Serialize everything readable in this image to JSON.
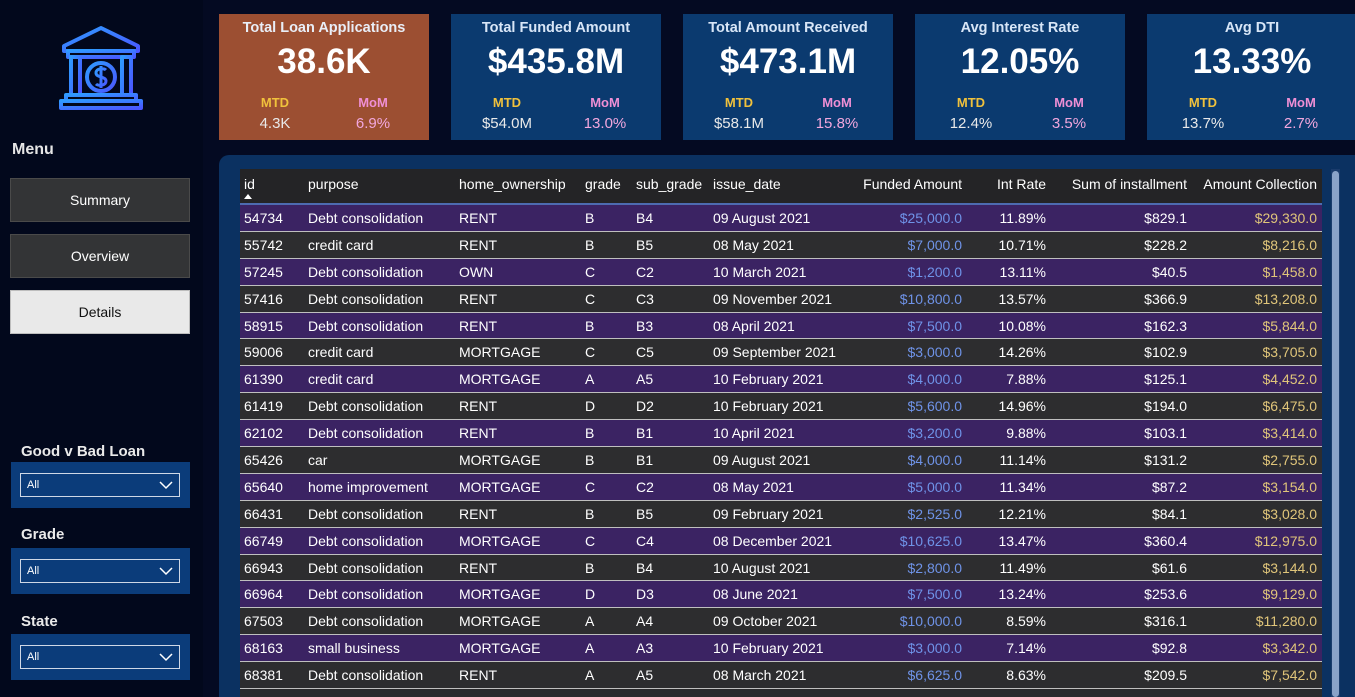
{
  "sidebar": {
    "menu_title": "Menu",
    "nav": [
      {
        "label": "Summary",
        "active": false
      },
      {
        "label": "Overview",
        "active": false
      },
      {
        "label": "Details",
        "active": true
      }
    ],
    "filters": [
      {
        "label": "Good v Bad Loan",
        "value": "All"
      },
      {
        "label": "Grade",
        "value": "All"
      },
      {
        "label": "State",
        "value": "All"
      }
    ],
    "logo_icon": "bank-dollar-icon"
  },
  "kpis": [
    {
      "title": "Total Loan Applications",
      "value": "38.6K",
      "mtd_label": "MTD",
      "mtd": "4.3K",
      "mom_label": "MoM",
      "mom": "6.9%",
      "color": "#9c4f32"
    },
    {
      "title": "Total Funded Amount",
      "value": "$435.8M",
      "mtd_label": "MTD",
      "mtd": "$54.0M",
      "mom_label": "MoM",
      "mom": "13.0%",
      "color": "#0b3a6f"
    },
    {
      "title": "Total Amount Received",
      "value": "$473.1M",
      "mtd_label": "MTD",
      "mtd": "$58.1M",
      "mom_label": "MoM",
      "mom": "15.8%",
      "color": "#0b3a6f"
    },
    {
      "title": "Avg Interest Rate",
      "value": "12.05%",
      "mtd_label": "MTD",
      "mtd": "12.4%",
      "mom_label": "MoM",
      "mom": "3.5%",
      "color": "#0b3a6f"
    },
    {
      "title": "Avg DTI",
      "value": "13.33%",
      "mtd_label": "MTD",
      "mtd": "13.7%",
      "mom_label": "MoM",
      "mom": "2.7%",
      "color": "#0b3a6f"
    }
  ],
  "table": {
    "columns": [
      "id",
      "purpose",
      "home_ownership",
      "grade",
      "sub_grade",
      "issue_date",
      "Funded Amount",
      "Int Rate",
      "Sum of installment",
      "Amount Collection"
    ],
    "rows": [
      [
        "54734",
        "Debt consolidation",
        "RENT",
        "B",
        "B4",
        "09 August 2021",
        "$25,000.0",
        "11.89%",
        "$829.1",
        "$29,330.0"
      ],
      [
        "55742",
        "credit card",
        "RENT",
        "B",
        "B5",
        "08 May 2021",
        "$7,000.0",
        "10.71%",
        "$228.2",
        "$8,216.0"
      ],
      [
        "57245",
        "Debt consolidation",
        "OWN",
        "C",
        "C2",
        "10 March 2021",
        "$1,200.0",
        "13.11%",
        "$40.5",
        "$1,458.0"
      ],
      [
        "57416",
        "Debt consolidation",
        "RENT",
        "C",
        "C3",
        "09 November 2021",
        "$10,800.0",
        "13.57%",
        "$366.9",
        "$13,208.0"
      ],
      [
        "58915",
        "Debt consolidation",
        "RENT",
        "B",
        "B3",
        "08 April 2021",
        "$7,500.0",
        "10.08%",
        "$162.3",
        "$5,844.0"
      ],
      [
        "59006",
        "credit card",
        "MORTGAGE",
        "C",
        "C5",
        "09 September 2021",
        "$3,000.0",
        "14.26%",
        "$102.9",
        "$3,705.0"
      ],
      [
        "61390",
        "credit card",
        "MORTGAGE",
        "A",
        "A5",
        "10 February 2021",
        "$4,000.0",
        "7.88%",
        "$125.1",
        "$4,452.0"
      ],
      [
        "61419",
        "Debt consolidation",
        "RENT",
        "D",
        "D2",
        "10 February 2021",
        "$5,600.0",
        "14.96%",
        "$194.0",
        "$6,475.0"
      ],
      [
        "62102",
        "Debt consolidation",
        "RENT",
        "B",
        "B1",
        "10 April 2021",
        "$3,200.0",
        "9.88%",
        "$103.1",
        "$3,414.0"
      ],
      [
        "65426",
        "car",
        "MORTGAGE",
        "B",
        "B1",
        "09 August 2021",
        "$4,000.0",
        "11.14%",
        "$131.2",
        "$2,755.0"
      ],
      [
        "65640",
        "home improvement",
        "MORTGAGE",
        "C",
        "C2",
        "08 May 2021",
        "$5,000.0",
        "11.34%",
        "$87.2",
        "$3,154.0"
      ],
      [
        "66431",
        "Debt consolidation",
        "RENT",
        "B",
        "B5",
        "09 February 2021",
        "$2,525.0",
        "12.21%",
        "$84.1",
        "$3,028.0"
      ],
      [
        "66749",
        "Debt consolidation",
        "MORTGAGE",
        "C",
        "C4",
        "08 December 2021",
        "$10,625.0",
        "13.47%",
        "$360.4",
        "$12,975.0"
      ],
      [
        "66943",
        "Debt consolidation",
        "RENT",
        "B",
        "B4",
        "10 August 2021",
        "$2,800.0",
        "11.49%",
        "$61.6",
        "$3,144.0"
      ],
      [
        "66964",
        "Debt consolidation",
        "MORTGAGE",
        "D",
        "D3",
        "08 June 2021",
        "$7,500.0",
        "13.24%",
        "$253.6",
        "$9,129.0"
      ],
      [
        "67503",
        "Debt consolidation",
        "MORTGAGE",
        "A",
        "A4",
        "09 October 2021",
        "$10,000.0",
        "8.59%",
        "$316.1",
        "$11,280.0"
      ],
      [
        "68163",
        "small business",
        "MORTGAGE",
        "A",
        "A3",
        "10 February 2021",
        "$3,000.0",
        "7.14%",
        "$92.8",
        "$3,342.0"
      ],
      [
        "68381",
        "Debt consolidation",
        "RENT",
        "A",
        "A5",
        "08 March 2021",
        "$6,625.0",
        "8.63%",
        "$209.5",
        "$7,542.0"
      ]
    ]
  },
  "colors": {
    "row_odd": "#3b2363",
    "row_even": "#2d2d2f",
    "funded_high": "#6f93e8",
    "collection": "#e0c57a",
    "mtd": "#f0c13c",
    "mom": "#ef8fd5"
  }
}
